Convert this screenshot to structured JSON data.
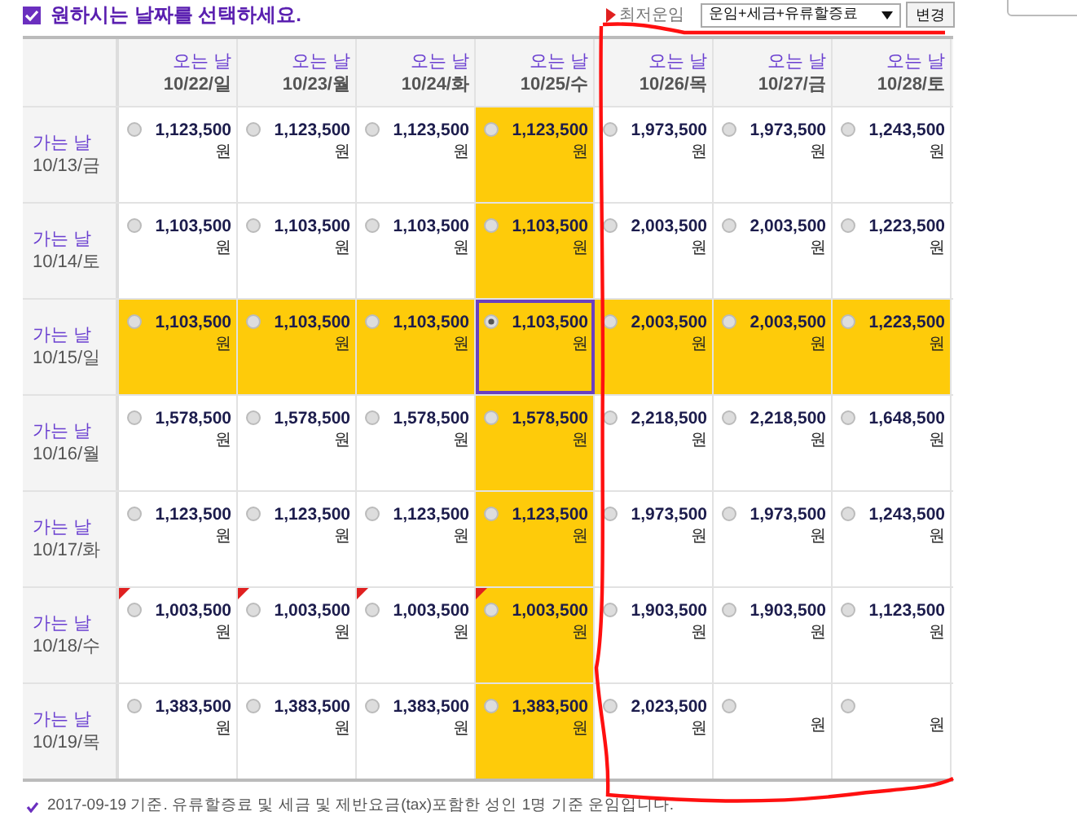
{
  "title": "원하시는 날짜를 선택하세요.",
  "legend": {
    "label": "최저운임"
  },
  "fare_select": {
    "value": "운임+세금+유류할증료"
  },
  "change_button": "변경",
  "columns": [
    {
      "label": "오는 날",
      "date": "10/22/일"
    },
    {
      "label": "오는 날",
      "date": "10/23/월"
    },
    {
      "label": "오는 날",
      "date": "10/24/화"
    },
    {
      "label": "오는 날",
      "date": "10/25/수"
    },
    {
      "label": "오는 날",
      "date": "10/26/목"
    },
    {
      "label": "오는 날",
      "date": "10/27/금"
    },
    {
      "label": "오는 날",
      "date": "10/28/토"
    }
  ],
  "rows": [
    {
      "label": "가는 날",
      "date": "10/13/금",
      "cells": [
        {
          "price": "1,123,500",
          "unit": "원",
          "selected": false,
          "highlighted": false,
          "lowest": false
        },
        {
          "price": "1,123,500",
          "unit": "원",
          "selected": false,
          "highlighted": false,
          "lowest": false
        },
        {
          "price": "1,123,500",
          "unit": "원",
          "selected": false,
          "highlighted": false,
          "lowest": false
        },
        {
          "price": "1,123,500",
          "unit": "원",
          "selected": false,
          "highlighted": true,
          "lowest": false
        },
        {
          "price": "1,973,500",
          "unit": "원",
          "selected": false,
          "highlighted": false,
          "lowest": false
        },
        {
          "price": "1,973,500",
          "unit": "원",
          "selected": false,
          "highlighted": false,
          "lowest": false
        },
        {
          "price": "1,243,500",
          "unit": "원",
          "selected": false,
          "highlighted": false,
          "lowest": false
        }
      ]
    },
    {
      "label": "가는 날",
      "date": "10/14/토",
      "cells": [
        {
          "price": "1,103,500",
          "unit": "원",
          "selected": false,
          "highlighted": false,
          "lowest": false
        },
        {
          "price": "1,103,500",
          "unit": "원",
          "selected": false,
          "highlighted": false,
          "lowest": false
        },
        {
          "price": "1,103,500",
          "unit": "원",
          "selected": false,
          "highlighted": false,
          "lowest": false
        },
        {
          "price": "1,103,500",
          "unit": "원",
          "selected": false,
          "highlighted": true,
          "lowest": false
        },
        {
          "price": "2,003,500",
          "unit": "원",
          "selected": false,
          "highlighted": false,
          "lowest": false
        },
        {
          "price": "2,003,500",
          "unit": "원",
          "selected": false,
          "highlighted": false,
          "lowest": false
        },
        {
          "price": "1,223,500",
          "unit": "원",
          "selected": false,
          "highlighted": false,
          "lowest": false
        }
      ]
    },
    {
      "label": "가는 날",
      "date": "10/15/일",
      "cells": [
        {
          "price": "1,103,500",
          "unit": "원",
          "selected": false,
          "highlighted": true,
          "lowest": false
        },
        {
          "price": "1,103,500",
          "unit": "원",
          "selected": false,
          "highlighted": true,
          "lowest": false
        },
        {
          "price": "1,103,500",
          "unit": "원",
          "selected": false,
          "highlighted": true,
          "lowest": false
        },
        {
          "price": "1,103,500",
          "unit": "원",
          "selected": true,
          "highlighted": true,
          "lowest": false
        },
        {
          "price": "2,003,500",
          "unit": "원",
          "selected": false,
          "highlighted": true,
          "lowest": false
        },
        {
          "price": "2,003,500",
          "unit": "원",
          "selected": false,
          "highlighted": true,
          "lowest": false
        },
        {
          "price": "1,223,500",
          "unit": "원",
          "selected": false,
          "highlighted": true,
          "lowest": false
        }
      ]
    },
    {
      "label": "가는 날",
      "date": "10/16/월",
      "cells": [
        {
          "price": "1,578,500",
          "unit": "원",
          "selected": false,
          "highlighted": false,
          "lowest": false
        },
        {
          "price": "1,578,500",
          "unit": "원",
          "selected": false,
          "highlighted": false,
          "lowest": false
        },
        {
          "price": "1,578,500",
          "unit": "원",
          "selected": false,
          "highlighted": false,
          "lowest": false
        },
        {
          "price": "1,578,500",
          "unit": "원",
          "selected": false,
          "highlighted": true,
          "lowest": false
        },
        {
          "price": "2,218,500",
          "unit": "원",
          "selected": false,
          "highlighted": false,
          "lowest": false
        },
        {
          "price": "2,218,500",
          "unit": "원",
          "selected": false,
          "highlighted": false,
          "lowest": false
        },
        {
          "price": "1,648,500",
          "unit": "원",
          "selected": false,
          "highlighted": false,
          "lowest": false
        }
      ]
    },
    {
      "label": "가는 날",
      "date": "10/17/화",
      "cells": [
        {
          "price": "1,123,500",
          "unit": "원",
          "selected": false,
          "highlighted": false,
          "lowest": false
        },
        {
          "price": "1,123,500",
          "unit": "원",
          "selected": false,
          "highlighted": false,
          "lowest": false
        },
        {
          "price": "1,123,500",
          "unit": "원",
          "selected": false,
          "highlighted": false,
          "lowest": false
        },
        {
          "price": "1,123,500",
          "unit": "원",
          "selected": false,
          "highlighted": true,
          "lowest": false
        },
        {
          "price": "1,973,500",
          "unit": "원",
          "selected": false,
          "highlighted": false,
          "lowest": false
        },
        {
          "price": "1,973,500",
          "unit": "원",
          "selected": false,
          "highlighted": false,
          "lowest": false
        },
        {
          "price": "1,243,500",
          "unit": "원",
          "selected": false,
          "highlighted": false,
          "lowest": false
        }
      ]
    },
    {
      "label": "가는 날",
      "date": "10/18/수",
      "cells": [
        {
          "price": "1,003,500",
          "unit": "원",
          "selected": false,
          "highlighted": false,
          "lowest": true
        },
        {
          "price": "1,003,500",
          "unit": "원",
          "selected": false,
          "highlighted": false,
          "lowest": true
        },
        {
          "price": "1,003,500",
          "unit": "원",
          "selected": false,
          "highlighted": false,
          "lowest": true
        },
        {
          "price": "1,003,500",
          "unit": "원",
          "selected": false,
          "highlighted": true,
          "lowest": true
        },
        {
          "price": "1,903,500",
          "unit": "원",
          "selected": false,
          "highlighted": false,
          "lowest": false
        },
        {
          "price": "1,903,500",
          "unit": "원",
          "selected": false,
          "highlighted": false,
          "lowest": false
        },
        {
          "price": "1,123,500",
          "unit": "원",
          "selected": false,
          "highlighted": false,
          "lowest": false
        }
      ]
    },
    {
      "label": "가는 날",
      "date": "10/19/목",
      "cells": [
        {
          "price": "1,383,500",
          "unit": "원",
          "selected": false,
          "highlighted": false,
          "lowest": false
        },
        {
          "price": "1,383,500",
          "unit": "원",
          "selected": false,
          "highlighted": false,
          "lowest": false
        },
        {
          "price": "1,383,500",
          "unit": "원",
          "selected": false,
          "highlighted": false,
          "lowest": false
        },
        {
          "price": "1,383,500",
          "unit": "원",
          "selected": false,
          "highlighted": true,
          "lowest": false
        },
        {
          "price": "2,023,500",
          "unit": "원",
          "selected": false,
          "highlighted": false,
          "lowest": false
        },
        {
          "unit": "원",
          "selected": false,
          "highlighted": false,
          "lowest": false
        },
        {
          "unit": "원",
          "selected": false,
          "highlighted": false,
          "lowest": false
        }
      ]
    }
  ],
  "note": "2017-09-19 기준. 유류할증료 및 세금 및 제반요금(tax)포함한 성인 1명 기준 운임입니다."
}
